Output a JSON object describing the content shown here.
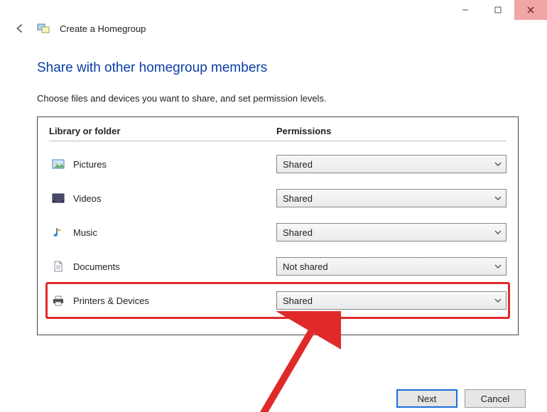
{
  "window": {
    "title": "Create a Homegroup"
  },
  "main": {
    "heading": "Share with other homegroup members",
    "instruction": "Choose files and devices you want to share, and set permission levels."
  },
  "columns": {
    "c1": "Library or folder",
    "c2": "Permissions"
  },
  "items": [
    {
      "label": "Pictures",
      "permission": "Shared",
      "icon": "pictures-icon"
    },
    {
      "label": "Videos",
      "permission": "Shared",
      "icon": "videos-icon"
    },
    {
      "label": "Music",
      "permission": "Shared",
      "icon": "music-icon"
    },
    {
      "label": "Documents",
      "permission": "Not shared",
      "icon": "documents-icon"
    },
    {
      "label": "Printers & Devices",
      "permission": "Shared",
      "icon": "printer-icon"
    }
  ],
  "buttons": {
    "next": "Next",
    "cancel": "Cancel"
  },
  "highlight_row_index": 4
}
